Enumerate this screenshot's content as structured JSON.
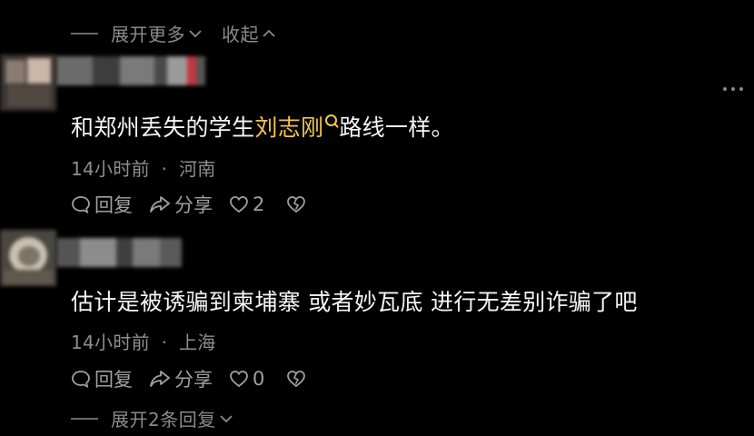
{
  "thread_top": {
    "expand_more_label": "展开更多",
    "collapse_label": "收起"
  },
  "comments": [
    {
      "text_before_link": "和郑州丢失的学生",
      "link_text": "刘志刚",
      "text_after_link": "路线一样。",
      "time": "14小时前",
      "separator": "·",
      "location": "河南",
      "reply_label": "回复",
      "share_label": "分享",
      "like_count": "2"
    },
    {
      "text": "估计是被诱骗到柬埔寨  或者妙瓦底  进行无差别诈骗了吧",
      "time": "14小时前",
      "separator": "·",
      "location": "上海",
      "reply_label": "回复",
      "share_label": "分享",
      "like_count": "0"
    }
  ],
  "thread_bottom": {
    "expand_replies_label": "展开2条回复"
  },
  "colors": {
    "background": "#000000",
    "link": "#f2c64a",
    "muted": "#8f8f8f",
    "text": "#f5f5f5"
  }
}
